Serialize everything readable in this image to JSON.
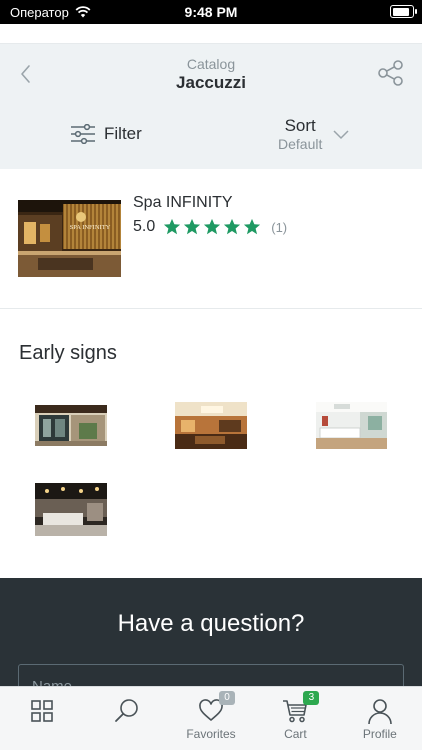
{
  "status_bar": {
    "carrier": "Оператор",
    "time": "9:48 PM",
    "battery_level": 0.9
  },
  "header": {
    "subtitle": "Catalog",
    "title": "Jaccuzzi",
    "filter_label": "Filter",
    "sort_label": "Sort",
    "sort_value": "Default"
  },
  "product": {
    "name": "Spa INFINITY",
    "thumb_caption": "SPA INFINITY",
    "rating": "5.0",
    "stars": 5,
    "review_count": "(1)"
  },
  "gallery": {
    "title": "Early signs",
    "images": [
      "photo-1",
      "photo-2",
      "photo-3",
      "photo-4"
    ]
  },
  "question": {
    "title": "Have a question?",
    "name_placeholder": "Name"
  },
  "tabbar": {
    "favorites_label": "Favorites",
    "favorites_badge": "0",
    "cart_label": "Cart",
    "cart_badge": "3",
    "profile_label": "Profile"
  },
  "colors": {
    "accent_green": "#1f9a63",
    "favorites_badge_bg": "#a9b3b8",
    "cart_badge_bg": "#2da84f",
    "header_bg": "#eef2f4",
    "dark_section_bg": "#2a3237"
  }
}
